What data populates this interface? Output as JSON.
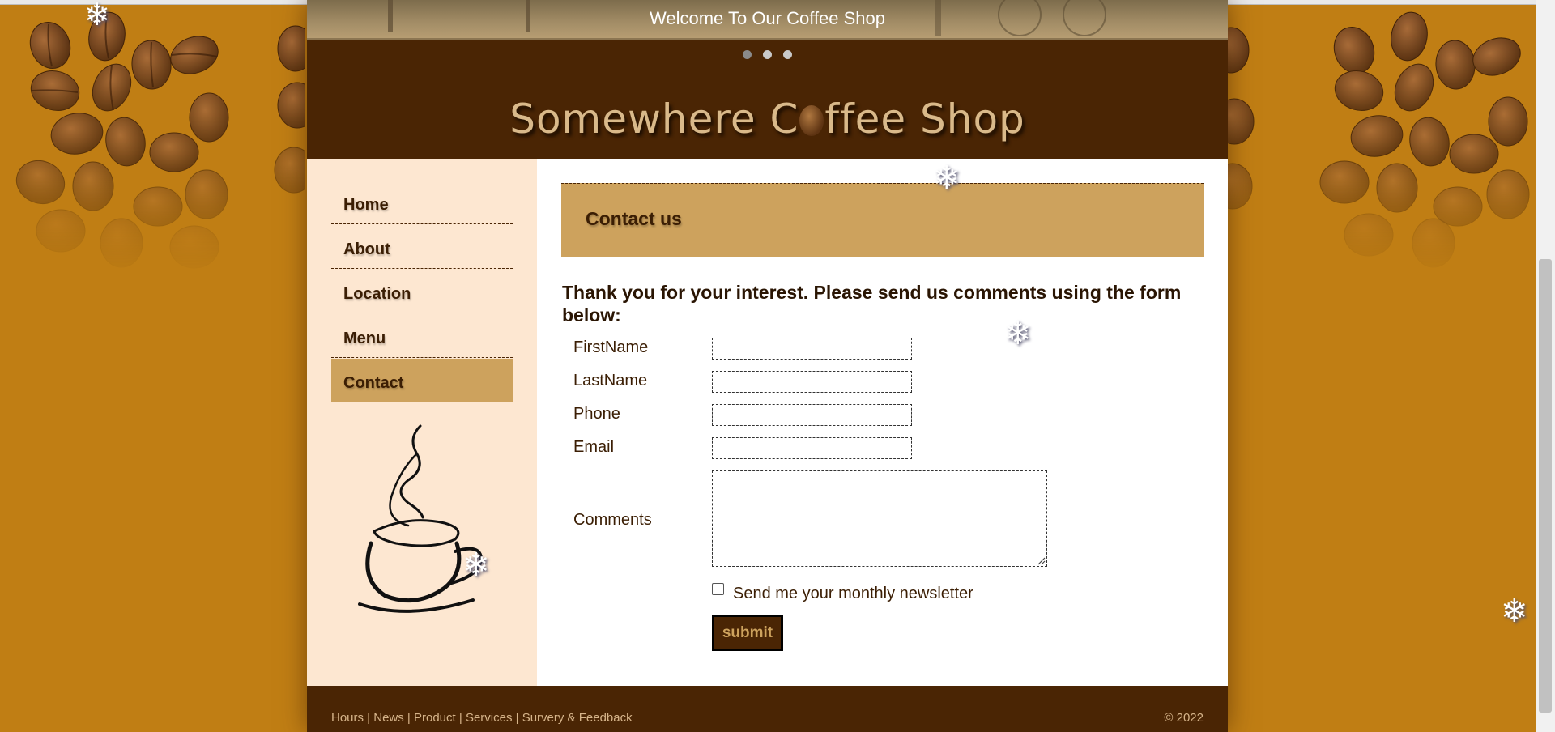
{
  "banner": {
    "text": "Welcome To Our Coffee Shop",
    "slides": 3,
    "active_slide": 1
  },
  "logo": {
    "before": "Somewhere C",
    "after": "ffee Shop"
  },
  "nav": {
    "items": [
      {
        "label": "Home"
      },
      {
        "label": "About"
      },
      {
        "label": "Location"
      },
      {
        "label": "Menu"
      },
      {
        "label": "Contact",
        "active": true
      }
    ]
  },
  "main": {
    "heading": "Contact us",
    "intro": "Thank you for your interest. Please send us comments using the form below:",
    "fields": {
      "first_name": {
        "label": "FirstName",
        "value": ""
      },
      "last_name": {
        "label": "LastName",
        "value": ""
      },
      "phone": {
        "label": "Phone",
        "value": ""
      },
      "email": {
        "label": "Email",
        "value": ""
      },
      "comments": {
        "label": "Comments",
        "value": ""
      }
    },
    "newsletter": {
      "label": "Send me your monthly newsletter",
      "checked": false
    },
    "submit_label": "submit"
  },
  "footer": {
    "links": [
      "Hours",
      "News",
      "Product",
      "Services",
      "Survery & Feedback"
    ],
    "copyright": "© 2022"
  },
  "colors": {
    "background": "#c07e14",
    "dark_brown": "#4a2504",
    "tan_accent": "#cda25d",
    "sidebar": "#fde7d1"
  }
}
